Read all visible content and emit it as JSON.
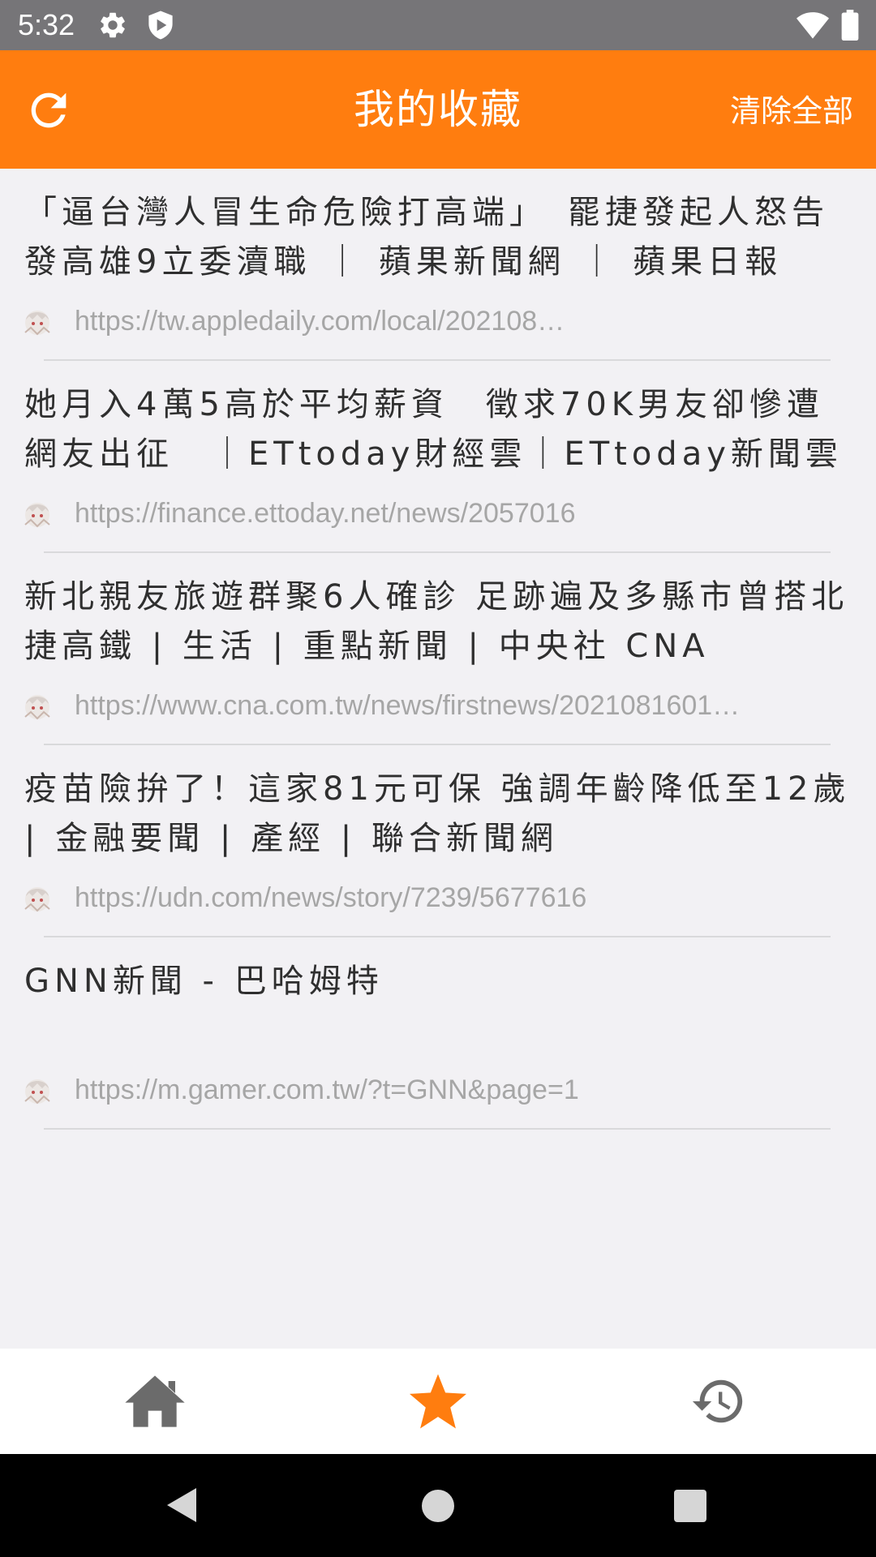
{
  "status_bar": {
    "time": "5:32",
    "icons": [
      "gear-icon",
      "shield-icon",
      "wifi-icon",
      "battery-icon"
    ]
  },
  "app_bar": {
    "title": "我的收藏",
    "clear_all_label": "清除全部",
    "refresh_icon": "refresh-icon"
  },
  "colors": {
    "accent": "#ff7d0f",
    "status_bar": "#767578",
    "background": "#f2f1f4",
    "nav_inactive": "#6b6b6b"
  },
  "favorites": [
    {
      "title": "「逼台灣人冒生命危險打高端」　罷捷發起人怒告發高雄9立委瀆職 ｜ 蘋果新聞網 ｜ 蘋果日報",
      "url": "https://tw.appledaily.com/local/202108…"
    },
    {
      "title": "她月入4萬5高於平均薪資　徵求70K男友卻慘遭網友出征　｜ETtoday財經雲｜ETtoday新聞雲",
      "url": "https://finance.ettoday.net/news/2057016"
    },
    {
      "title": "新北親友旅遊群聚6人確診 足跡遍及多縣市曾搭北捷高鐵 | 生活 | 重點新聞 | 中央社 CNA",
      "url": "https://www.cna.com.tw/news/firstnews/2021081601…"
    },
    {
      "title": "疫苗險拚了！這家81元可保 強調年齡降低至12歲 | 金融要聞 | 產經 | 聯合新聞網",
      "url": "https://udn.com/news/story/7239/5677616"
    },
    {
      "title": "GNN新聞 - 巴哈姆特",
      "url": "https://m.gamer.com.tw/?t=GNN&page=1"
    }
  ],
  "bottom_nav": {
    "items": [
      "home-icon",
      "star-icon",
      "history-icon"
    ],
    "active": "star-icon"
  },
  "system_nav": [
    "back-icon",
    "home-circle-icon",
    "recents-icon"
  ]
}
